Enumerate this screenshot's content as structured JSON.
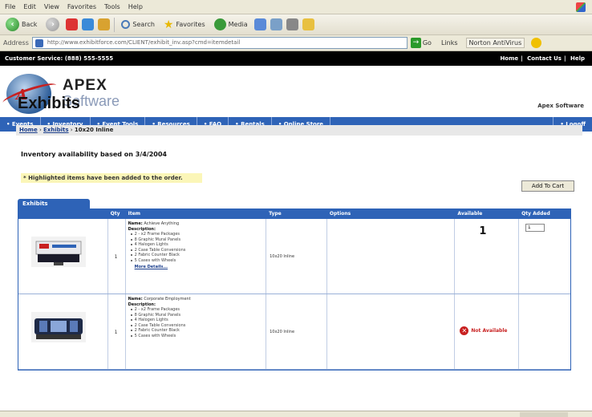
{
  "browser": {
    "menu": [
      "File",
      "Edit",
      "View",
      "Favorites",
      "Tools",
      "Help"
    ],
    "toolbar": {
      "back_label": "Back",
      "search_label": "Search",
      "favorites_label": "Favorites",
      "media_label": "Media"
    },
    "address": {
      "label": "Address",
      "url": "http://www.exhibitforce.com/CLIENT/exhibit_inv.asp?cmd=itemdetail",
      "go_label": "Go",
      "links_label": "Links",
      "norton_label": "Norton AntiVirus"
    }
  },
  "site": {
    "customer_service": "Customer Service: (888) 555-5555",
    "top_links": [
      "Home",
      "Contact Us",
      "Help"
    ],
    "logo": {
      "name": "APEX",
      "sub": "Software"
    },
    "nav": [
      "Events",
      "Inventory",
      "Event Tools",
      "Resources",
      "FAQ",
      "Rentals",
      "Online Store",
      "Logoff"
    ]
  },
  "main": {
    "title": "Exhibits",
    "company": "Apex Software",
    "breadcrumb": {
      "home": "Home",
      "exhibits": "Exhibits",
      "current": "10x20 Inline"
    },
    "inventory_note": "Inventory availability based on 3/4/2004",
    "highlight_note": "* Highlighted items have been added to the order.",
    "add_to_cart": "Add To Cart"
  },
  "grid": {
    "tab_label": "Exhibits",
    "columns": [
      "",
      "Qty",
      "Item",
      "Type",
      "Options",
      "Available",
      "Qty Added"
    ],
    "rows": [
      {
        "qty": "1",
        "name_label": "Name:",
        "name": "Achieve Anything",
        "desc_label": "Description:",
        "bullets": [
          "2 - x2 Frame Packages",
          "8 Graphic Mural Panels",
          "4 Halogen Lights",
          "2 Case Table Conversions",
          "2 Fabric Counter Black",
          "5 Cases with Wheels"
        ],
        "more": "More Details...",
        "type": "10x20 Inline",
        "available": "1",
        "qty_added": "1"
      },
      {
        "qty": "1",
        "name_label": "Name:",
        "name": "Corporate Employment",
        "desc_label": "Description:",
        "bullets": [
          "2 - x2 Frame Packages",
          "8 Graphic Mural Panels",
          "4 Halogen Lights",
          "2 Case Table Conversions",
          "2 Fabric Counter Black",
          "5 Cases with Wheels"
        ],
        "type": "10x20 Inline",
        "available": "Not Available"
      }
    ]
  }
}
